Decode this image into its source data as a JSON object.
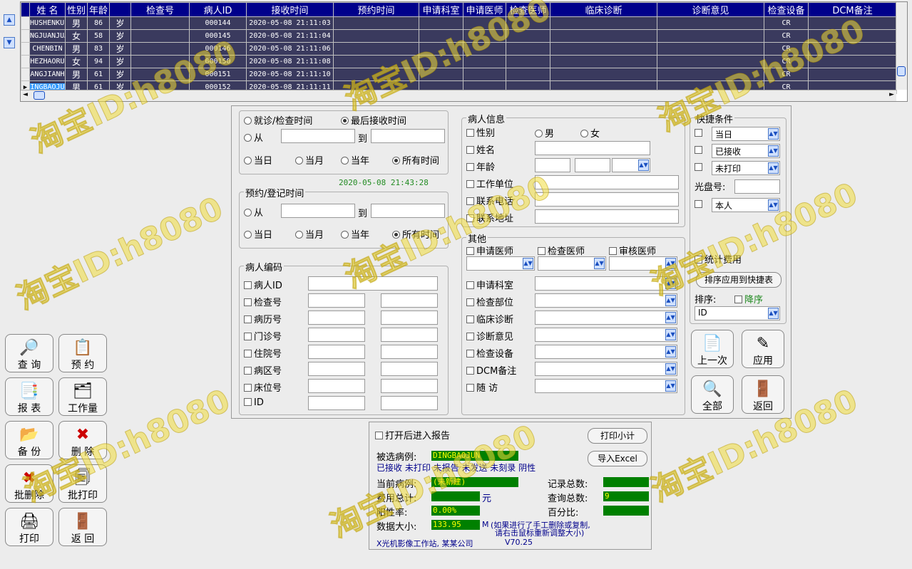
{
  "grid": {
    "headers": [
      "姓 名",
      "性别",
      "年龄",
      "",
      "检查号",
      "病人ID",
      "接收时间",
      "预约时间",
      "申请科室",
      "申请医师",
      "检查医师",
      "临床诊断",
      "诊断意见",
      "检查设备",
      "DCM备注"
    ],
    "rows": [
      {
        "name": "HUSHENKUI",
        "sex": "男",
        "age": "86",
        "unit": "岁",
        "pid": "000144",
        "time": "2020-05-08 21:11:03",
        "dev": "CR"
      },
      {
        "name": "NGJUANJUAN",
        "sex": "女",
        "age": "58",
        "unit": "岁",
        "pid": "000145",
        "time": "2020-05-08 21:11:04",
        "dev": "CR"
      },
      {
        "name": "CHENBIN",
        "sex": "男",
        "age": "83",
        "unit": "岁",
        "pid": "000146",
        "time": "2020-05-08 21:11:06",
        "dev": "CR"
      },
      {
        "name": "HEZHAORU",
        "sex": "女",
        "age": "94",
        "unit": "岁",
        "pid": "000150",
        "time": "2020-05-08 21:11:08",
        "dev": "CR"
      },
      {
        "name": "ANGJIANH",
        "sex": "男",
        "age": "61",
        "unit": "岁",
        "pid": "000151",
        "time": "2020-05-08 21:11:10",
        "dev": "CR"
      },
      {
        "name": "INGBAOJU",
        "sex": "男",
        "age": "61",
        "unit": "岁",
        "pid": "000152",
        "time": "2020-05-08 21:11:11",
        "dev": "CR"
      }
    ],
    "current_row_marker": "▶"
  },
  "time_group": {
    "opt_visit": "就诊/检查时间",
    "opt_last_recv": "最后接收时间",
    "from": "从",
    "to": "到",
    "today": "当日",
    "month": "当月",
    "year": "当年",
    "all": "所有时间",
    "now": "2020-05-08 21:43:28"
  },
  "appt_group": {
    "title": "预约/登记时间",
    "from": "从",
    "to": "到",
    "today": "当日",
    "month": "当月",
    "year": "当年",
    "all": "所有时间"
  },
  "code_group": {
    "title": "病人编码",
    "items": [
      "病人ID",
      "检查号",
      "病历号",
      "门诊号",
      "住院号",
      "病区号",
      "床位号",
      "ID"
    ]
  },
  "patient_group": {
    "title": "病人信息",
    "sex": "性别",
    "male": "男",
    "female": "女",
    "name": "姓名",
    "age": "年龄",
    "work": "工作单位",
    "phone": "联系电话",
    "addr": "联系地址"
  },
  "other_group": {
    "title": "其他",
    "req_doc": "申请医师",
    "chk_doc": "检查医师",
    "rev_doc": "审核医师",
    "items": [
      "申请科室",
      "检查部位",
      "临床诊断",
      "诊断意见",
      "检查设备",
      "DCM备注",
      "随  访"
    ]
  },
  "quick_group": {
    "title": "快捷条件",
    "c1": "当日",
    "c2": "已接收",
    "c3": "未打印",
    "disc": "光盘号:",
    "c4": "本人",
    "stat_fee": "统计费用",
    "apply_sort": "排序应用到快捷表",
    "sort": "排序:",
    "desc": "降序",
    "sort_val": "ID"
  },
  "right_buttons": {
    "prev": "上一次",
    "apply": "应用",
    "all": "全部",
    "back": "返回"
  },
  "left_buttons": {
    "query": "查 询",
    "appt": "预 约",
    "report": "报 表",
    "workload": "工作量",
    "backup": "备 份",
    "delete": "删 除",
    "batch_del": "批删除",
    "batch_print": "批打印",
    "print": "打印",
    "ret": "返 回"
  },
  "status": {
    "open_report": "打开后进入报告",
    "print_sub": "打印小计",
    "export": "导入Excel",
    "selected": "被选病例:",
    "selected_val": "DINGBAOJUN",
    "flags": "已接收 未打印 未报告 未发送 未刻录 阴性",
    "current": "当前病例:",
    "current_val": "(未新建)",
    "records": "记录总数:",
    "fee": "费用总计:",
    "yuan": "元",
    "query_total": "查询总数:",
    "query_val": "9",
    "pos_rate": "阳性率:",
    "pos_val": "0.00%",
    "percent": "百分比:",
    "data_size": "数据大小:",
    "size_val": "133.95",
    "size_unit": "M",
    "note1": "(如果进行了手工删除或复制,",
    "note2": "请右击鼠标重新调整大小)",
    "footer": "X光机影像工作站, 某某公司",
    "version": "V70.25"
  },
  "watermark": "淘宝ID:h8080"
}
